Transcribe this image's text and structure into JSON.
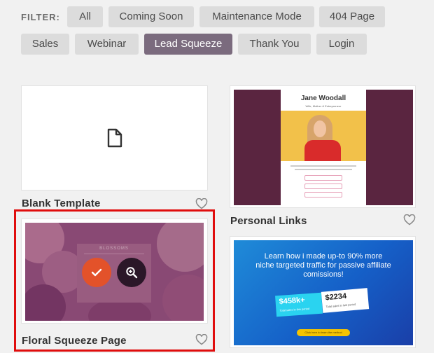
{
  "filter": {
    "label": "FILTER:",
    "chips": [
      "All",
      "Coming Soon",
      "Maintenance Mode",
      "404 Page",
      "Sales",
      "Webinar",
      "Lead Squeeze",
      "Thank You",
      "Login"
    ],
    "active": "Lead Squeeze"
  },
  "templates": {
    "blank": {
      "title": "Blank Template",
      "icon": "document-icon"
    },
    "personal_links": {
      "title": "Personal Links",
      "preview_name": "Jane Woodall",
      "preview_subtitle": "Wife, Mother & Entrepreneur"
    },
    "floral": {
      "title": "Floral Squeeze Page",
      "preview_brand": "BLOSSOMS",
      "select_icon": "check-icon",
      "preview_icon": "zoom-icon"
    },
    "affiliate": {
      "preview_headline": "Learn how i made up-to 90% more niche targeted traffic for passive affiliate comissions!",
      "stat1_value": "$458k+",
      "stat1_label": "Total sales in this period",
      "stat2_value": "$2234",
      "stat2_label": "Total sales in last period",
      "cta": "Click here to learn the method"
    }
  },
  "colors": {
    "accent_red": "#e00d0d",
    "active_chip": "#7b6b7e",
    "select_orange": "#e3522a"
  }
}
